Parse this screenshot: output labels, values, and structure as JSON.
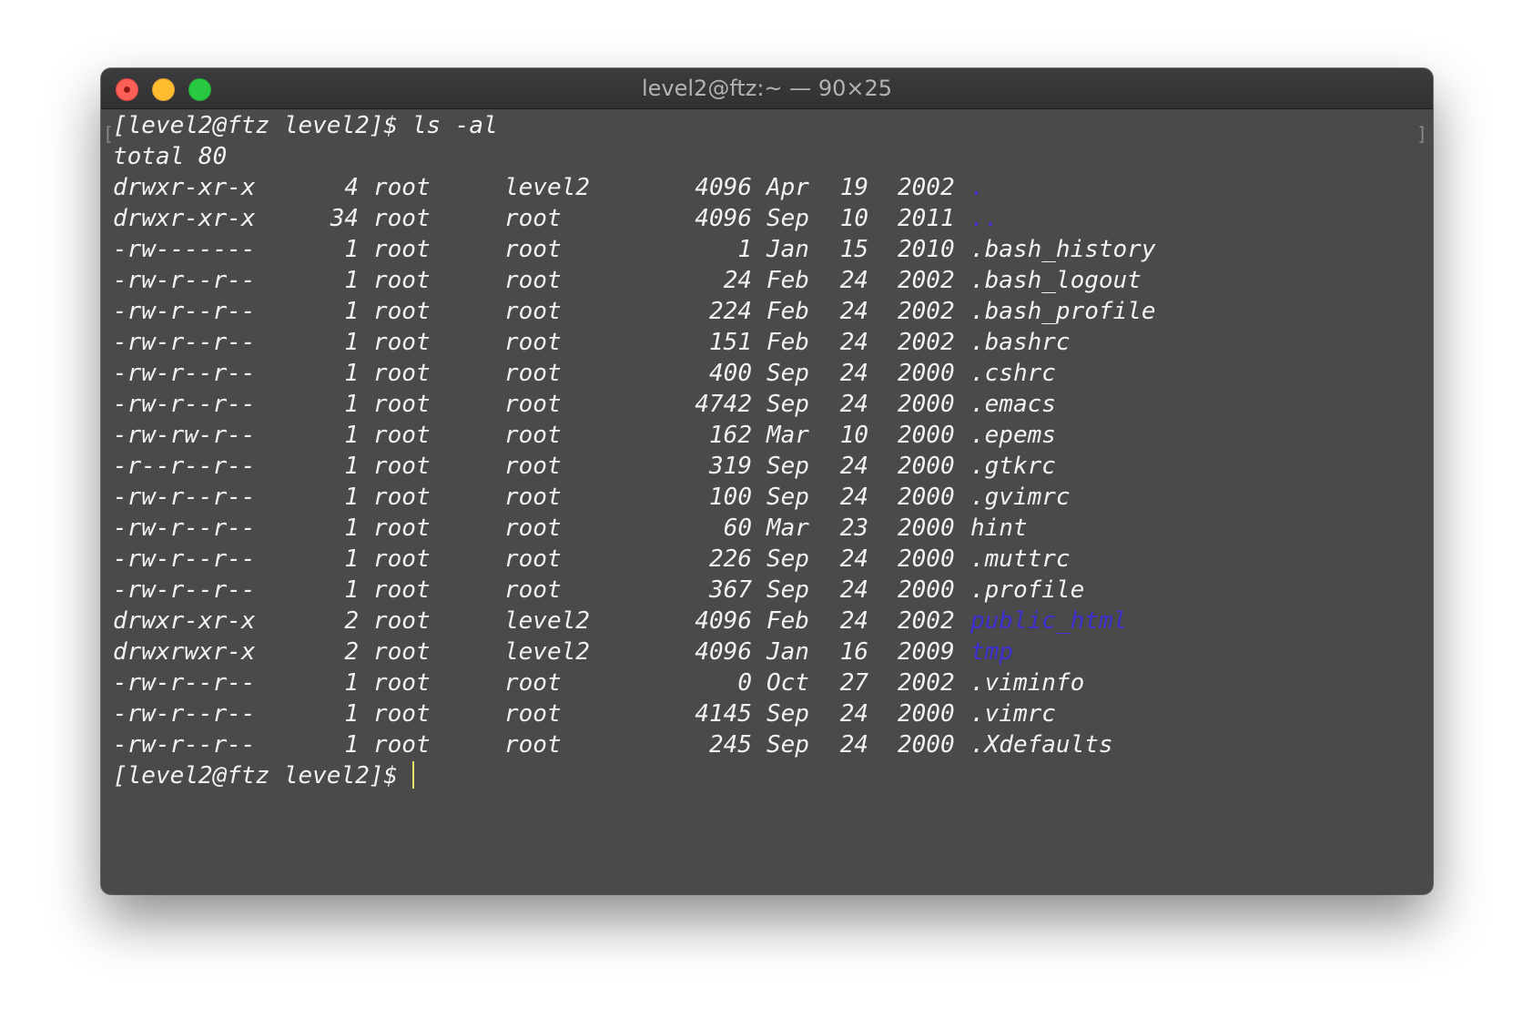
{
  "window": {
    "title": "level2@ftz:~ — 90×25",
    "colors": {
      "background": "#4a4a4a",
      "text": "#f2f2f2",
      "directory": "#3d2ecf",
      "cursor": "#e8e86a"
    }
  },
  "terminal": {
    "prompt": "[level2@ftz level2]$",
    "command": "ls -al",
    "total_line": "total 80",
    "final_prompt": "[level2@ftz level2]$",
    "entries": [
      {
        "perm": "drwxr-xr-x",
        "links": "4",
        "owner": "root",
        "group": "level2",
        "size": "4096",
        "month": "Apr",
        "day": "19",
        "year": "2002",
        "name": ".",
        "is_dir": true
      },
      {
        "perm": "drwxr-xr-x",
        "links": "34",
        "owner": "root",
        "group": "root",
        "size": "4096",
        "month": "Sep",
        "day": "10",
        "year": "2011",
        "name": "..",
        "is_dir": true
      },
      {
        "perm": "-rw-------",
        "links": "1",
        "owner": "root",
        "group": "root",
        "size": "1",
        "month": "Jan",
        "day": "15",
        "year": "2010",
        "name": ".bash_history",
        "is_dir": false
      },
      {
        "perm": "-rw-r--r--",
        "links": "1",
        "owner": "root",
        "group": "root",
        "size": "24",
        "month": "Feb",
        "day": "24",
        "year": "2002",
        "name": ".bash_logout",
        "is_dir": false
      },
      {
        "perm": "-rw-r--r--",
        "links": "1",
        "owner": "root",
        "group": "root",
        "size": "224",
        "month": "Feb",
        "day": "24",
        "year": "2002",
        "name": ".bash_profile",
        "is_dir": false
      },
      {
        "perm": "-rw-r--r--",
        "links": "1",
        "owner": "root",
        "group": "root",
        "size": "151",
        "month": "Feb",
        "day": "24",
        "year": "2002",
        "name": ".bashrc",
        "is_dir": false
      },
      {
        "perm": "-rw-r--r--",
        "links": "1",
        "owner": "root",
        "group": "root",
        "size": "400",
        "month": "Sep",
        "day": "24",
        "year": "2000",
        "name": ".cshrc",
        "is_dir": false
      },
      {
        "perm": "-rw-r--r--",
        "links": "1",
        "owner": "root",
        "group": "root",
        "size": "4742",
        "month": "Sep",
        "day": "24",
        "year": "2000",
        "name": ".emacs",
        "is_dir": false
      },
      {
        "perm": "-rw-rw-r--",
        "links": "1",
        "owner": "root",
        "group": "root",
        "size": "162",
        "month": "Mar",
        "day": "10",
        "year": "2000",
        "name": ".epems",
        "is_dir": false
      },
      {
        "perm": "-r--r--r--",
        "links": "1",
        "owner": "root",
        "group": "root",
        "size": "319",
        "month": "Sep",
        "day": "24",
        "year": "2000",
        "name": ".gtkrc",
        "is_dir": false
      },
      {
        "perm": "-rw-r--r--",
        "links": "1",
        "owner": "root",
        "group": "root",
        "size": "100",
        "month": "Sep",
        "day": "24",
        "year": "2000",
        "name": ".gvimrc",
        "is_dir": false
      },
      {
        "perm": "-rw-r--r--",
        "links": "1",
        "owner": "root",
        "group": "root",
        "size": "60",
        "month": "Mar",
        "day": "23",
        "year": "2000",
        "name": "hint",
        "is_dir": false
      },
      {
        "perm": "-rw-r--r--",
        "links": "1",
        "owner": "root",
        "group": "root",
        "size": "226",
        "month": "Sep",
        "day": "24",
        "year": "2000",
        "name": ".muttrc",
        "is_dir": false
      },
      {
        "perm": "-rw-r--r--",
        "links": "1",
        "owner": "root",
        "group": "root",
        "size": "367",
        "month": "Sep",
        "day": "24",
        "year": "2000",
        "name": ".profile",
        "is_dir": false
      },
      {
        "perm": "drwxr-xr-x",
        "links": "2",
        "owner": "root",
        "group": "level2",
        "size": "4096",
        "month": "Feb",
        "day": "24",
        "year": "2002",
        "name": "public_html",
        "is_dir": true
      },
      {
        "perm": "drwxrwxr-x",
        "links": "2",
        "owner": "root",
        "group": "level2",
        "size": "4096",
        "month": "Jan",
        "day": "16",
        "year": "2009",
        "name": "tmp",
        "is_dir": true
      },
      {
        "perm": "-rw-r--r--",
        "links": "1",
        "owner": "root",
        "group": "root",
        "size": "0",
        "month": "Oct",
        "day": "27",
        "year": "2002",
        "name": ".viminfo",
        "is_dir": false
      },
      {
        "perm": "-rw-r--r--",
        "links": "1",
        "owner": "root",
        "group": "root",
        "size": "4145",
        "month": "Sep",
        "day": "24",
        "year": "2000",
        "name": ".vimrc",
        "is_dir": false
      },
      {
        "perm": "-rw-r--r--",
        "links": "1",
        "owner": "root",
        "group": "root",
        "size": "245",
        "month": "Sep",
        "day": "24",
        "year": "2000",
        "name": ".Xdefaults",
        "is_dir": false
      }
    ]
  }
}
